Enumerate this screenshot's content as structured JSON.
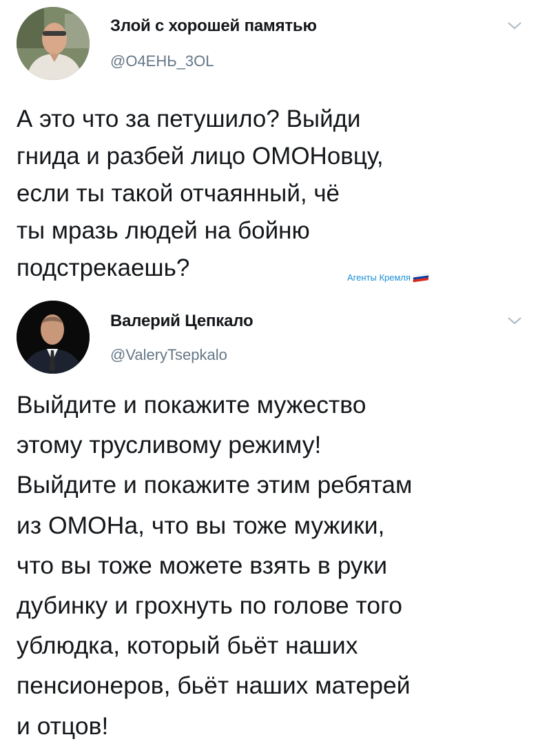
{
  "tweets": [
    {
      "display_name": "Злой с хорошей памятью",
      "handle": "@О4ЕНЬ_3ОL",
      "text": "А это что за петушило? Выйди\nгнида и разбей лицо ОМОНовцу,\nесли ты такой отчаянный, чё\nты мразь людей на бойню\nподстрекаешь?",
      "avatar_icon": "man-portrait-avatar",
      "menu_icon": "chevron-down-icon"
    },
    {
      "display_name": "Валерий Цепкало",
      "handle": "@ValeryTsepkalo",
      "text": "Выйдите и покажите мужество\nэтому трусливому режиму!\nВыйдите и покажите этим ребятам\nиз ОМОНа, что вы тоже мужики,\nчто вы тоже можете взять в руки\nдубинку и грохнуть по голове того\nублюдка, который бьёт наших\nпенсионеров, бьёт наших матерей\nи отцов!",
      "avatar_icon": "man-in-suit-avatar",
      "menu_icon": "chevron-down-icon"
    }
  ],
  "watermark": {
    "text": "Агенты Кремля",
    "flag_colors": [
      "#ffffff",
      "#0039a6",
      "#d52b1e"
    ]
  },
  "colors": {
    "text": "#14171a",
    "secondary": "#657786",
    "watermark": "#1a8fd6"
  }
}
